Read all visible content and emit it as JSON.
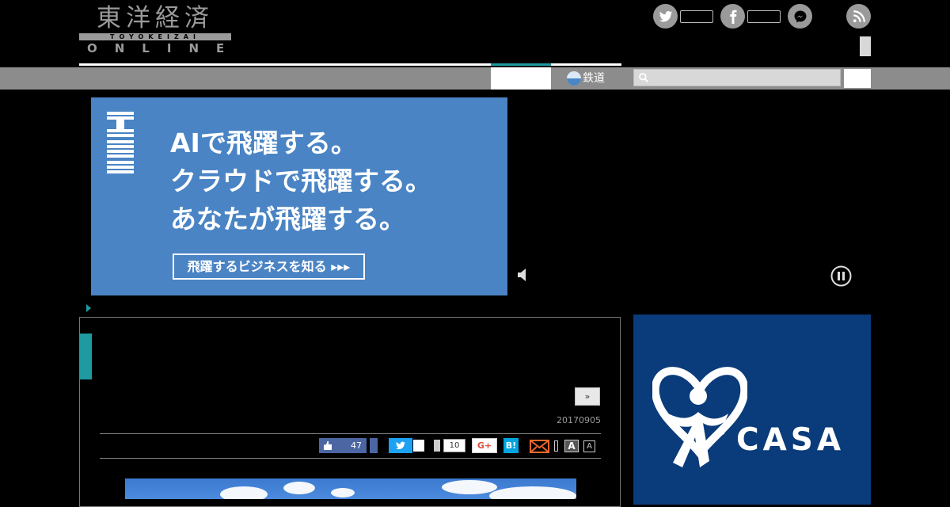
{
  "header": {
    "logo": {
      "kanji": "東洋経済",
      "band": "TOYOKEIZAI",
      "online": "ONLINE"
    }
  },
  "nav": {
    "rail_label": "鉄道",
    "search": {
      "value": "",
      "placeholder": ""
    }
  },
  "ad_banner": {
    "brand": "IBM",
    "headline": [
      "AIで飛躍する。",
      "クラウドで飛躍する。",
      "あなたが飛躍する。"
    ],
    "cta": "飛躍するビジネスを知る ▸▸▸"
  },
  "article": {
    "next_label": "»",
    "date": "20170905",
    "share": {
      "like_count": "47",
      "hatena_count": "10",
      "gplus_label": "G+",
      "hatebu_label": "B!",
      "font_large": "A",
      "font_small": "A"
    }
  },
  "side_ad": {
    "brand": "CASA",
    "reg_mark": "®"
  },
  "icons": {
    "twitter": "twitter-icon",
    "facebook": "facebook-icon",
    "messenger": "messenger-icon",
    "rss": "rss-icon",
    "search": "search-icon",
    "mute": "speaker-mute-icon",
    "pause": "pause-icon",
    "mail": "mail-icon",
    "thumb": "thumbs-up-icon"
  },
  "colors": {
    "accent_teal": "#1f9aa0",
    "nav_gray": "#8c8c8c",
    "ad_blue": "#4a84c4",
    "facebook_blue": "#4c66a4",
    "twitter_blue": "#1da1f2",
    "casa_navy": "#0a3b7a"
  }
}
